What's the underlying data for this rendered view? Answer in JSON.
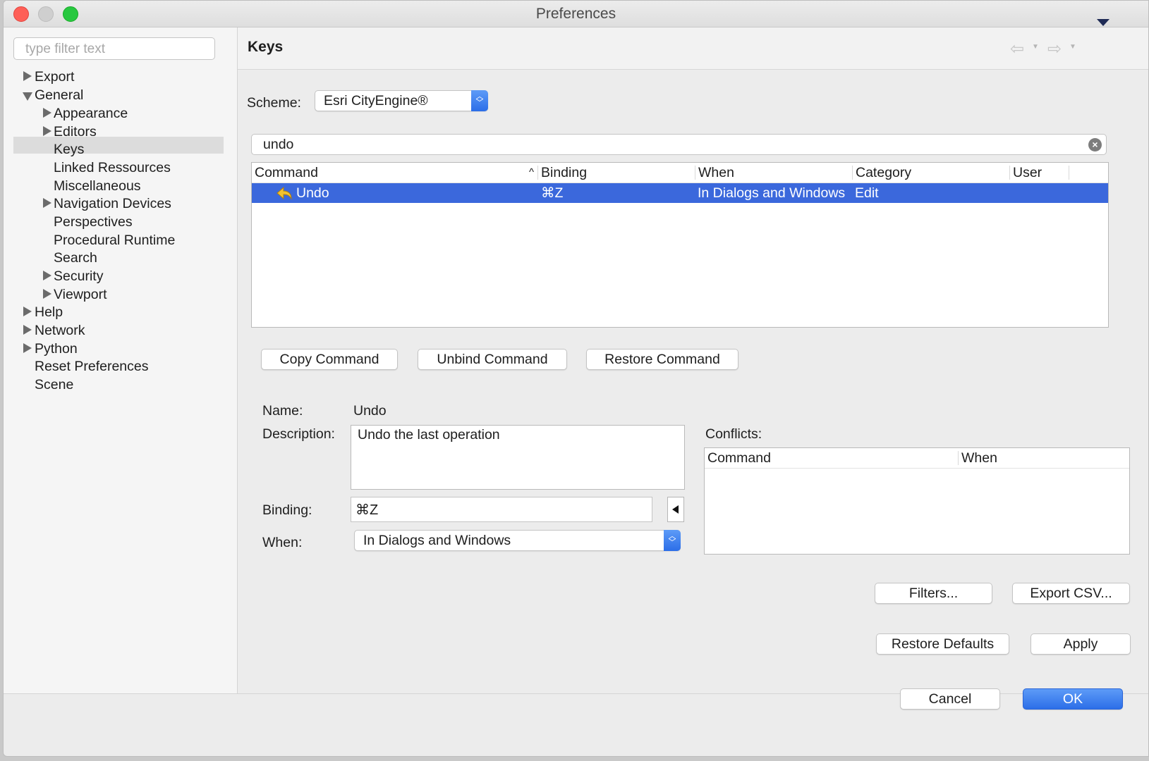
{
  "window": {
    "title": "Preferences"
  },
  "sidebar": {
    "filter_placeholder": "type filter text",
    "items": [
      {
        "label": "Export",
        "expander": "closed"
      },
      {
        "label": "General",
        "expander": "open"
      },
      {
        "label": "Appearance",
        "expander": "closed"
      },
      {
        "label": "Editors",
        "expander": "closed"
      },
      {
        "label": "Keys",
        "expander": "none",
        "selected": true
      },
      {
        "label": "Linked Ressources",
        "expander": "none"
      },
      {
        "label": "Miscellaneous",
        "expander": "none"
      },
      {
        "label": "Navigation Devices",
        "expander": "closed"
      },
      {
        "label": "Perspectives",
        "expander": "none"
      },
      {
        "label": "Procedural Runtime",
        "expander": "none"
      },
      {
        "label": "Search",
        "expander": "none"
      },
      {
        "label": "Security",
        "expander": "closed"
      },
      {
        "label": "Viewport",
        "expander": "closed"
      },
      {
        "label": "Help",
        "expander": "closed"
      },
      {
        "label": "Network",
        "expander": "closed"
      },
      {
        "label": "Python",
        "expander": "closed"
      },
      {
        "label": "Reset Preferences",
        "expander": "none"
      },
      {
        "label": "Scene",
        "expander": "none"
      }
    ]
  },
  "page": {
    "title": "Keys",
    "scheme_label": "Scheme:",
    "scheme_value": "Esri CityEngine®",
    "search_value": "undo",
    "table": {
      "headers": [
        "Command",
        "Binding",
        "When",
        "Category",
        "User"
      ],
      "rows": [
        {
          "command": "Undo",
          "binding": "⌘Z",
          "when": "In Dialogs and Windows",
          "category": "Edit",
          "user": ""
        }
      ]
    },
    "buttons": {
      "copy": "Copy Command",
      "unbind": "Unbind Command",
      "restore": "Restore Command"
    },
    "details": {
      "name_label": "Name:",
      "name_value": "Undo",
      "description_label": "Description:",
      "description_value": "Undo the last operation",
      "binding_label": "Binding:",
      "binding_value": "⌘Z",
      "when_label": "When:",
      "when_value": "In Dialogs and Windows"
    },
    "conflicts": {
      "label": "Conflicts:",
      "headers": [
        "Command",
        "When"
      ]
    },
    "filters_button": "Filters...",
    "export_button": "Export CSV...",
    "restore_defaults": "Restore Defaults",
    "apply": "Apply"
  },
  "footer": {
    "cancel": "Cancel",
    "ok": "OK"
  },
  "colors": {
    "selection": "#3b68dc",
    "accent": "#2c6ee8",
    "close": "#fe5f57",
    "maximize": "#28c840"
  }
}
